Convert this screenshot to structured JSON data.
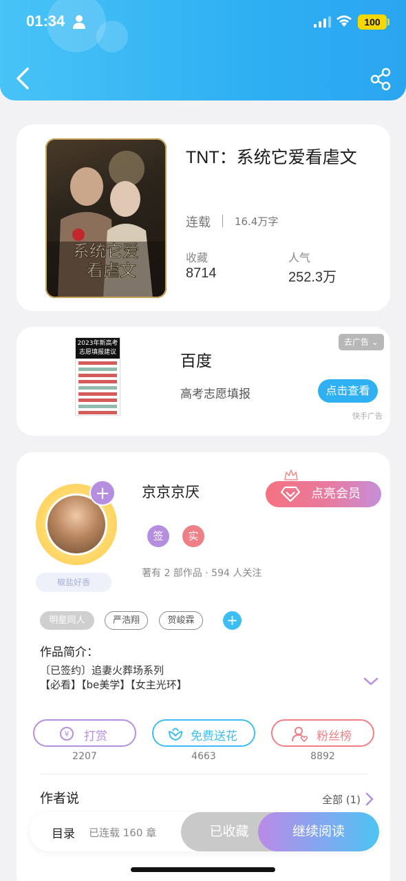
{
  "status_bar": {
    "time": "01:34",
    "battery": "100"
  },
  "book": {
    "title": "TNT：系统它爱看虐文",
    "status": "连载",
    "words": "16.4万字",
    "favorites_label": "收藏",
    "favorites": "8714",
    "popularity_label": "人气",
    "popularity": "252.3万",
    "cover_text": "系统它爱看虐文"
  },
  "ad": {
    "thumb_text": "2023年新高考志愿填报建议",
    "title": "百度",
    "desc": "高考志愿填报",
    "close_label": "去广告",
    "cta": "点击查看",
    "source": "快手广告"
  },
  "author": {
    "name": "京京京厌",
    "tag": "椒盐好香",
    "vip_label": "点亮会员",
    "badge_signed": "签",
    "badge_real": "实",
    "works": "著有 2 部作品 · 594 人关注",
    "tags": [
      "明星同人",
      "严浩翔",
      "贺峻霖"
    ],
    "intro_label": "作品简介：",
    "intro_line1": "〔已签约〕追妻火葬场系列",
    "intro_line2": "【必看】【be美学】【女主光环】"
  },
  "actions": [
    {
      "label": "打赏",
      "count": "2207",
      "color": "#b58ee0"
    },
    {
      "label": "免费送花",
      "count": "4663",
      "color": "#3cbef2"
    },
    {
      "label": "粉丝榜",
      "count": "8892",
      "color": "#ee7f86"
    }
  ],
  "author_says": {
    "title": "作者说",
    "all": "全部 (1)"
  },
  "bottom_bar": {
    "toc": "目录",
    "chapters": "已连载 160 章",
    "collected": "已收藏",
    "continue": "继续阅读"
  }
}
